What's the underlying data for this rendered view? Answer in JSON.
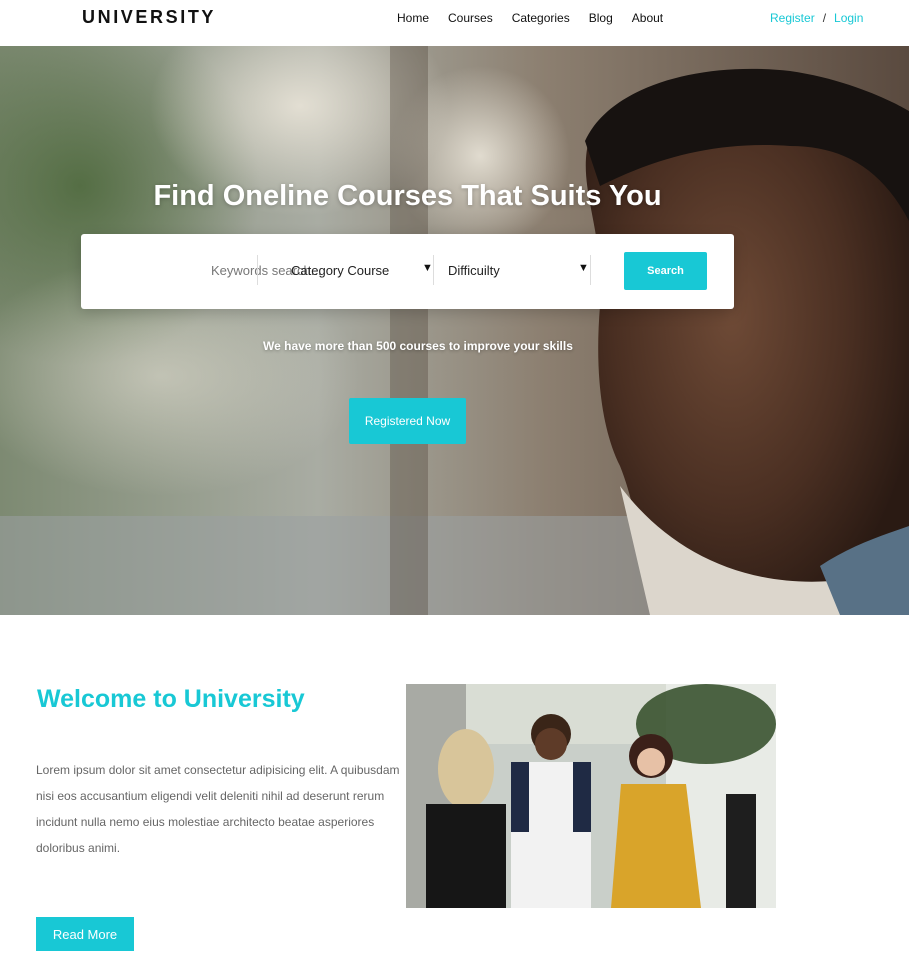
{
  "header": {
    "logo": "UNIVERSITY",
    "nav": [
      "Home",
      "Courses",
      "Categories",
      "Blog",
      "About"
    ],
    "register": "Register",
    "separator": "/",
    "login": "Login"
  },
  "hero": {
    "title": "Find Oneline Courses That Suits You",
    "search": {
      "keyword_placeholder": "Keywords search...",
      "category_value": "Category Course",
      "difficulty_value": "Difficuilty",
      "button": "Search"
    },
    "subtitle": "We have more than 500 courses to improve your skills",
    "cta": "Registered Now"
  },
  "welcome": {
    "title": "Welcome to University",
    "body": "Lorem ipsum dolor sit amet consectetur adipisicing elit. A quibusdam nisi eos accusantium eligendi velit deleniti nihil ad deserunt rerum incidunt nulla nemo eius molestiae architecto beatae asperiores doloribus animi.",
    "button": "Read More"
  },
  "colors": {
    "accent": "#18c8d5",
    "text_dark": "#111111",
    "text_muted": "#666666"
  }
}
